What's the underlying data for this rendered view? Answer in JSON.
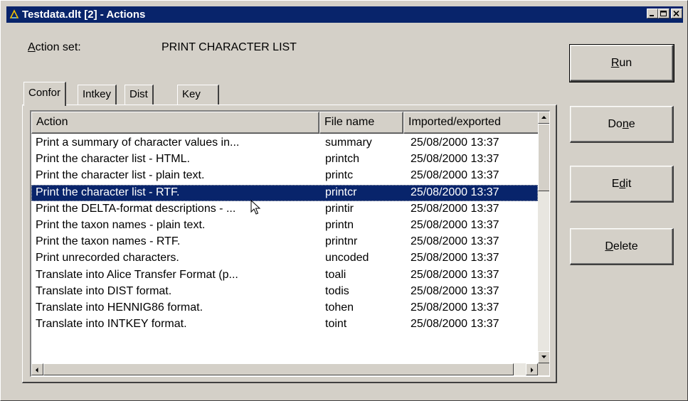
{
  "window": {
    "title": "Testdata.dlt [2] - Actions"
  },
  "action_set": {
    "label": "Action set:",
    "value": "PRINT CHARACTER LIST"
  },
  "tabs": [
    {
      "label": "Confor",
      "active": true
    },
    {
      "label": "Intkey",
      "active": false
    },
    {
      "label": "Dist",
      "active": false
    },
    {
      "label": "Key",
      "active": false
    }
  ],
  "table": {
    "columns": [
      "Action",
      "File name",
      "Imported/exported"
    ],
    "rows": [
      {
        "action": "Print a summary of character values in...",
        "file": "summary",
        "imported": "25/08/2000 13:37"
      },
      {
        "action": "Print the character list - HTML.",
        "file": "printch",
        "imported": "25/08/2000 13:37"
      },
      {
        "action": "Print the character list - plain text.",
        "file": "printc",
        "imported": "25/08/2000 13:37"
      },
      {
        "action": "Print the character list - RTF.",
        "file": "printcr",
        "imported": "25/08/2000 13:37",
        "selected": true
      },
      {
        "action": "Print the DELTA-format descriptions - ...",
        "file": "printir",
        "imported": "25/08/2000 13:37"
      },
      {
        "action": "Print the taxon names - plain text.",
        "file": "printn",
        "imported": "25/08/2000 13:37"
      },
      {
        "action": "Print the taxon names - RTF.",
        "file": "printnr",
        "imported": "25/08/2000 13:37"
      },
      {
        "action": "Print unrecorded characters.",
        "file": "uncoded",
        "imported": "25/08/2000 13:37"
      },
      {
        "action": "Translate into Alice Transfer Format (p...",
        "file": "toali",
        "imported": "25/08/2000 13:37"
      },
      {
        "action": "Translate into DIST format.",
        "file": "todis",
        "imported": "25/08/2000 13:37"
      },
      {
        "action": "Translate into HENNIG86 format.",
        "file": "tohen",
        "imported": "25/08/2000 13:37"
      },
      {
        "action": "Translate into INTKEY format.",
        "file": "toint",
        "imported": "25/08/2000 13:37"
      }
    ]
  },
  "buttons": {
    "run": {
      "pre": "",
      "key": "R",
      "post": "un"
    },
    "done": {
      "pre": "Do",
      "key": "n",
      "post": "e"
    },
    "edit": {
      "pre": "E",
      "key": "d",
      "post": "it"
    },
    "delete": {
      "pre": "",
      "key": "D",
      "post": "elete"
    }
  },
  "colors": {
    "titlebar": "#08246b",
    "face": "#d4d0c8",
    "selection": "#08246b"
  }
}
